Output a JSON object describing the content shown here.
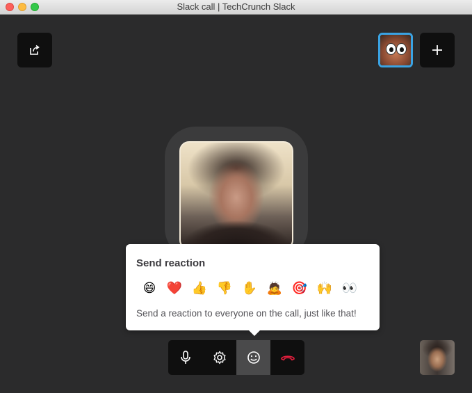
{
  "window": {
    "title": "Slack call | TechCrunch Slack"
  },
  "toolbar": {
    "share_icon": "share-screen-icon",
    "add_icon": "plus-icon"
  },
  "reaction_popover": {
    "title": "Send reaction",
    "emojis": [
      "😄",
      "❤️",
      "👍",
      "👎",
      "✋",
      "🙇",
      "🎯",
      "🙌",
      "👀"
    ],
    "description": "Send a reaction to everyone on the call, just like that!"
  },
  "controls": {
    "icons": [
      "microphone-icon",
      "gear-icon",
      "smiley-icon",
      "hang-up-icon"
    ]
  },
  "colors": {
    "accent": "#3aa3e3",
    "hangup": "#e01e3c",
    "background": "#2b2b2c"
  }
}
